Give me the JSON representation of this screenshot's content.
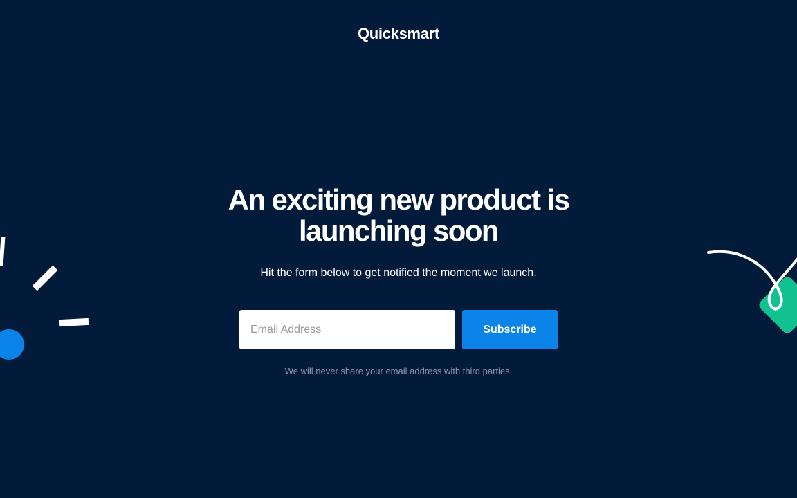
{
  "brand": {
    "name": "Quicksmart"
  },
  "hero": {
    "headline": "An exciting new product is launching soon",
    "subtext": "Hit the form below to get notified the moment we launch."
  },
  "form": {
    "email_placeholder": "Email Address",
    "email_value": "",
    "subscribe_label": "Subscribe"
  },
  "privacy_note": "We will never share your email address with third parties.",
  "colors": {
    "background": "#031b3a",
    "button": "#0a84e8",
    "accent_green": "#12c18f",
    "accent_blue": "#0a84e8",
    "muted_text": "#8a96aa"
  }
}
